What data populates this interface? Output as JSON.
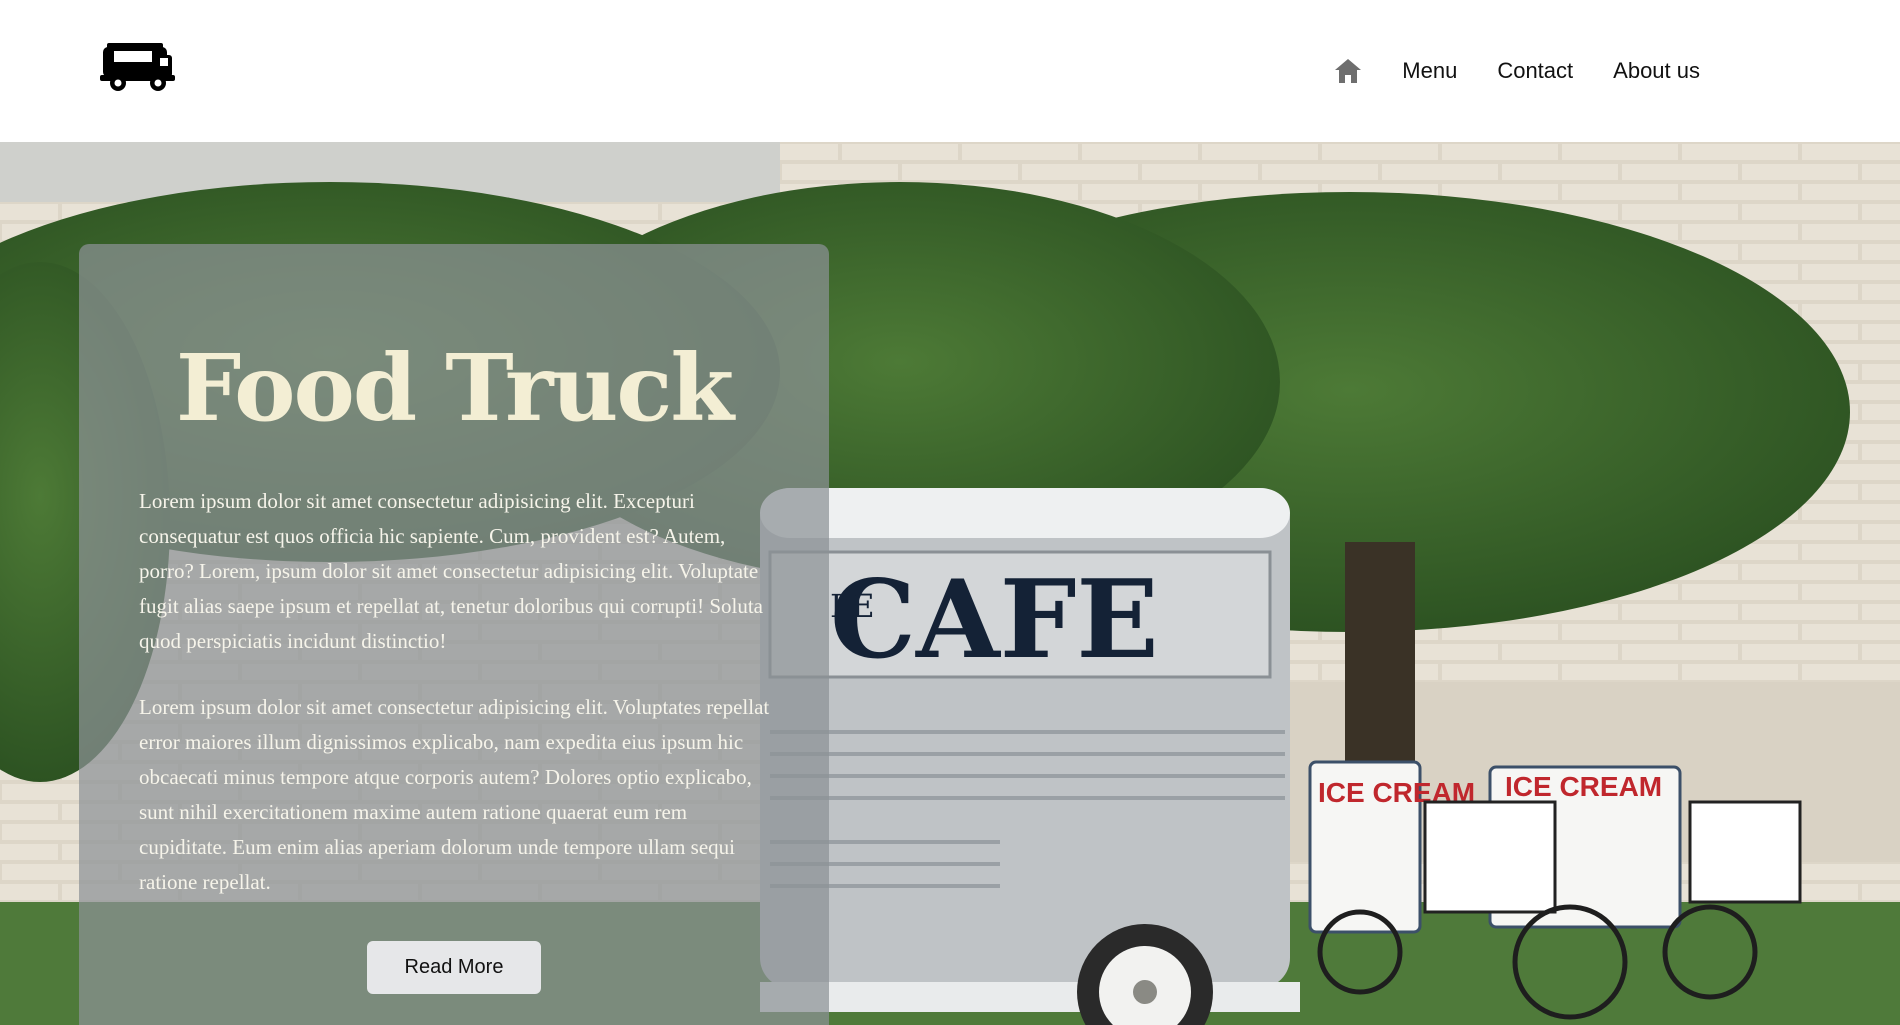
{
  "header": {
    "logo_icon": "food-truck-icon",
    "nav": {
      "home_icon": "home-icon",
      "menu": "Menu",
      "contact": "Contact",
      "about": "About us"
    }
  },
  "hero": {
    "title": "Food Truck",
    "paragraph1": "Lorem ipsum dolor sit amet consectetur adipisicing elit. Excepturi consequatur est quos officia hic sapiente. Cum, provident est? Autem, porro? Lorem, ipsum dolor sit amet consectetur adipisicing elit. Voluptate fugit alias saepe ipsum et repellat at, tenetur doloribus qui corrupti! Soluta quod perspiciatis incidunt distinctio!",
    "paragraph2": "Lorem ipsum dolor sit amet consectetur adipisicing elit. Voluptates repellat error maiores illum dignissimos explicabo, nam expedita eius ipsum hic obcaecati minus tempore atque corporis autem? Dolores optio explicabo, sunt nihil exercitationem maxime autem ratione quaerat eum rem cupiditate. Eum enim alias aperiam dolorum unde tempore ullam sequi ratione repellat.",
    "read_more": "Read More"
  },
  "photo_signs": {
    "truck_sign": "CAFE",
    "truck_sign_partial": "LE",
    "cart_sign": "ICE CREAM"
  },
  "colors": {
    "title": "#f3eed4",
    "panel": "#8c9196",
    "foliage": "#3f6a2e",
    "wall": "#ddd6c8",
    "truck": "#bfc3c6",
    "sign_text": "#142236",
    "cart_text": "#c0272d"
  }
}
